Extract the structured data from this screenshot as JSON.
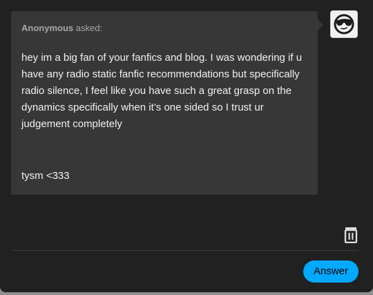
{
  "ask": {
    "asker_name": "Anonymous",
    "asked_label": " asked:",
    "body_paragraph": "hey im a big fan of your fanfics and blog. I was wondering if u have any radio static fanfic recommendations but specifically radio silence, I feel like you have such a great grasp on the dynamics specifically when it’s one sided so I trust ur judgement completely",
    "signoff": "tysm <333"
  },
  "avatar": {
    "icon": "sunglasses-face-icon"
  },
  "actions": {
    "delete_icon": "trash-icon",
    "answer_label": "Answer"
  },
  "colors": {
    "background": "#212121",
    "bubble": "#373737",
    "accent": "#00a8ff",
    "text": "#f2f2f2",
    "muted_text": "#a7a7a7"
  }
}
